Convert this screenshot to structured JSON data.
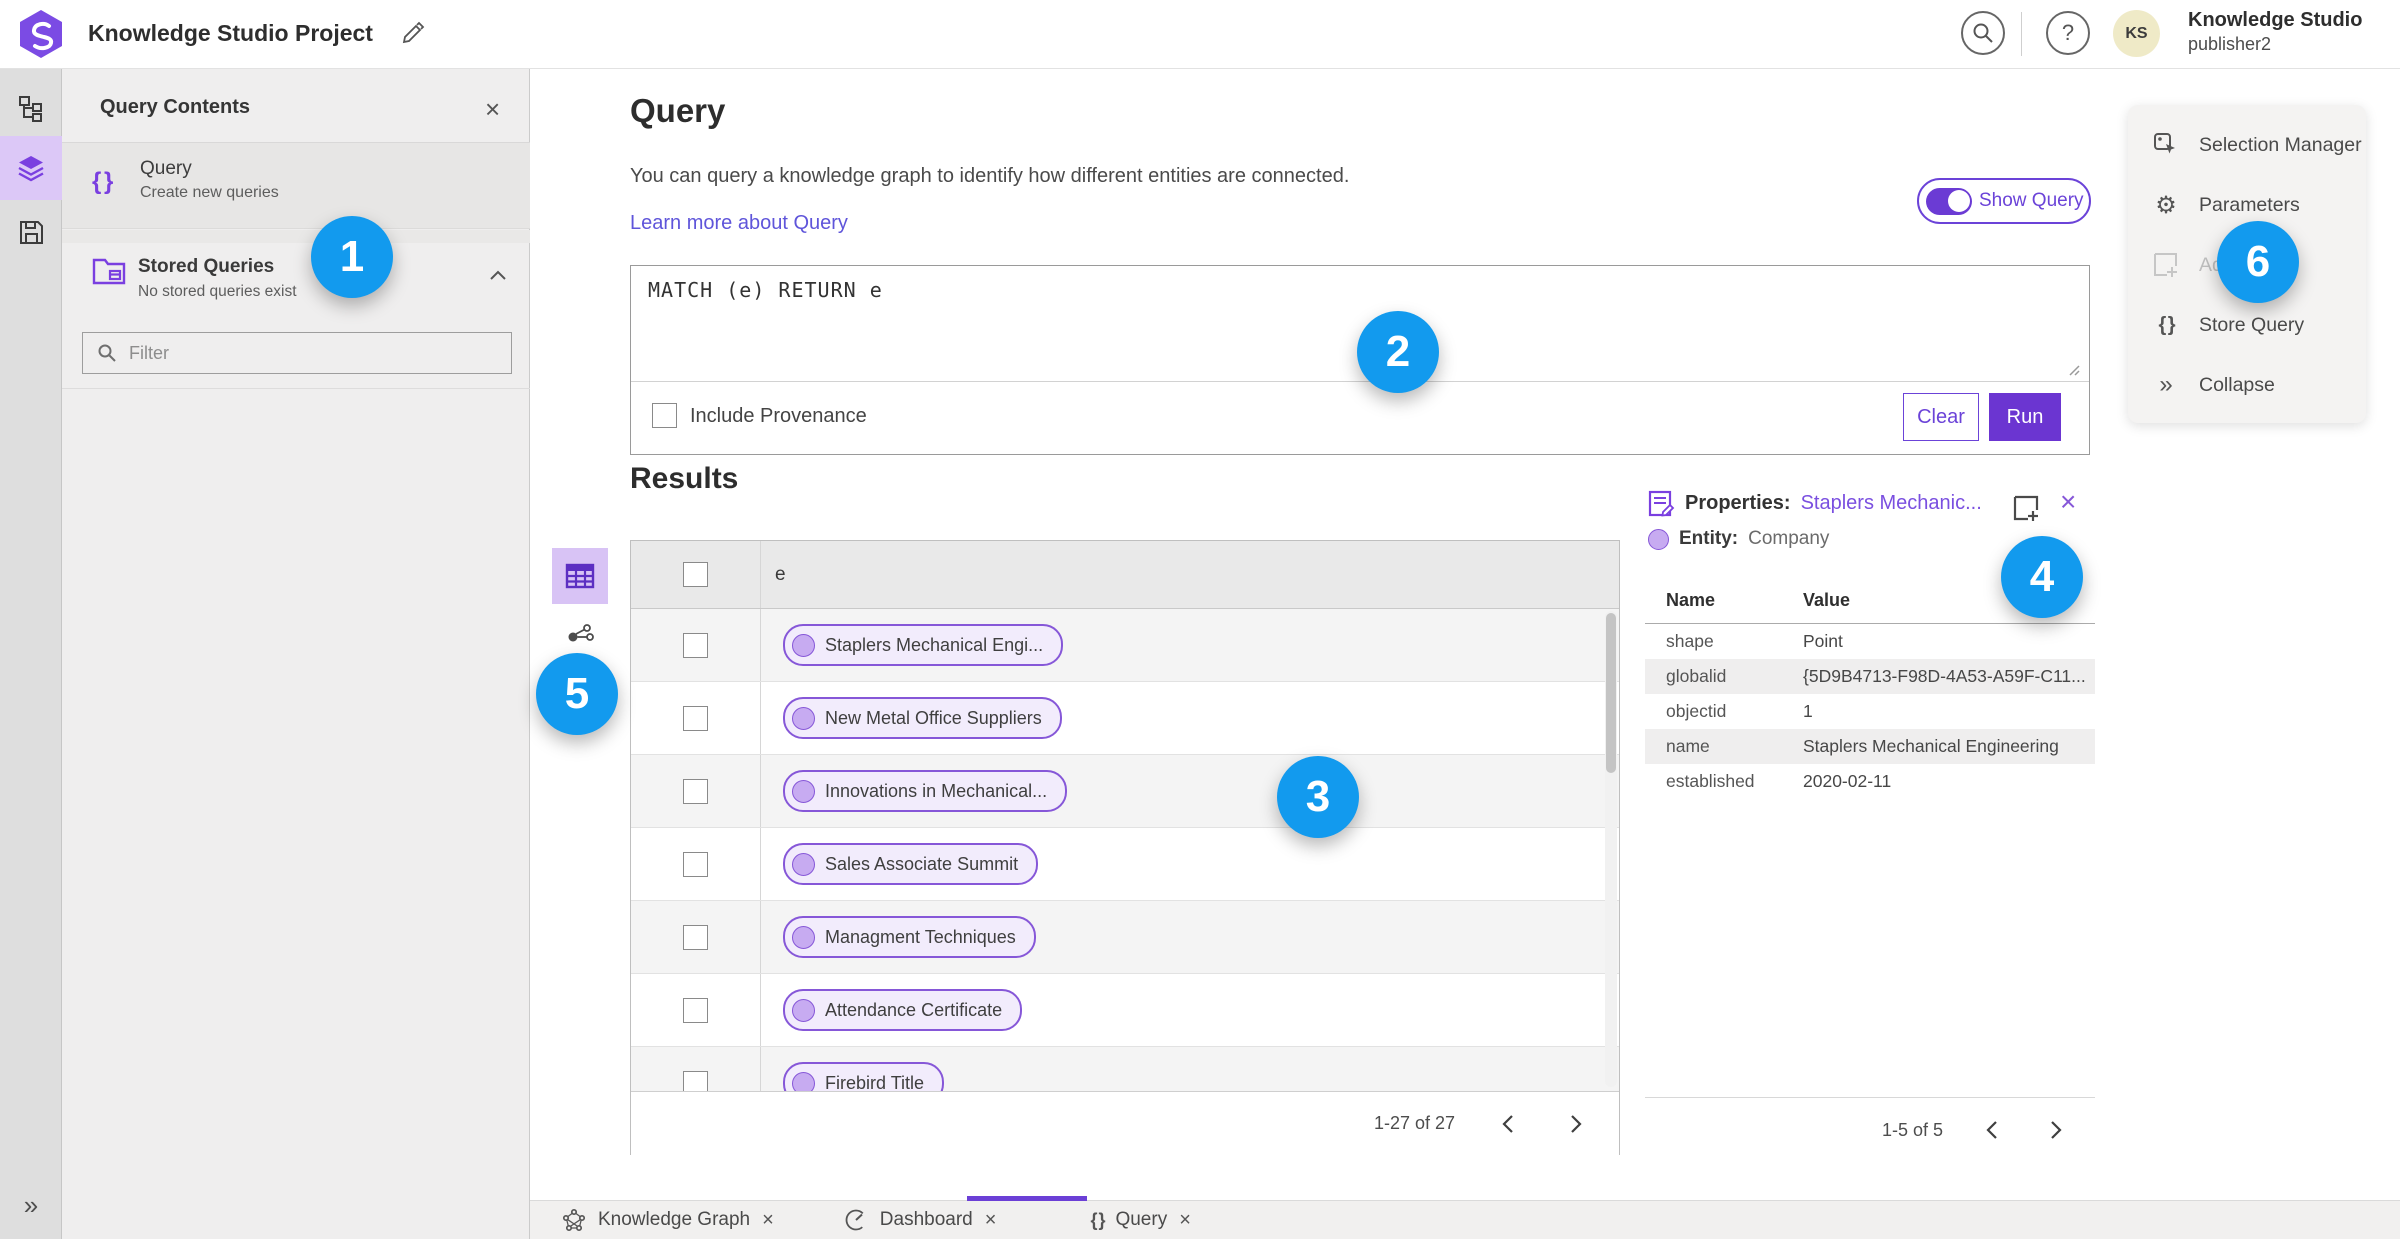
{
  "header": {
    "app_title": "Knowledge Studio Project",
    "user_name": "Knowledge Studio",
    "user_role": "publisher2",
    "avatar_initials": "KS",
    "help_glyph": "?"
  },
  "query_contents_panel": {
    "title": "Query Contents",
    "query_item": {
      "title": "Query",
      "subtitle": "Create new queries"
    },
    "stored_queries": {
      "title": "Stored Queries",
      "subtitle": "No stored queries exist"
    },
    "filter_placeholder": "Filter"
  },
  "query_section": {
    "title": "Query",
    "description": "You can query a knowledge graph to identify how different entities are connected.",
    "learn_more": "Learn more about Query",
    "show_query_label": "Show Query",
    "query_text": "MATCH (e) RETURN e",
    "include_provenance_label": "Include Provenance",
    "clear_label": "Clear",
    "run_label": "Run"
  },
  "results": {
    "title": "Results",
    "column_header": "e",
    "rows": [
      "Staplers Mechanical Engi...",
      "New Metal Office Suppliers",
      "Innovations in Mechanical...",
      "Sales Associate Summit",
      "Managment Techniques",
      "Attendance Certificate",
      "Firebird Title"
    ],
    "pagination": "1-27 of 27"
  },
  "properties_panel": {
    "title": "Properties:",
    "entity_link": "Staplers Mechanic...",
    "entity_label": "Entity:",
    "entity_type": "Company",
    "columns": {
      "name": "Name",
      "value": "Value"
    },
    "rows": [
      [
        "shape",
        "Point"
      ],
      [
        "globalid",
        "{5D9B4713-F98D-4A53-A59F-C11..."
      ],
      [
        "objectid",
        "1"
      ],
      [
        "name",
        "Staplers Mechanical Engineering"
      ],
      [
        "established",
        "2020-02-11"
      ]
    ],
    "pagination": "1-5 of 5"
  },
  "side_menu": {
    "items": [
      {
        "label": "Selection Manager"
      },
      {
        "label": "Parameters"
      },
      {
        "label": "Add",
        "disabled": true
      },
      {
        "label": "Store Query"
      },
      {
        "label": "Collapse"
      }
    ]
  },
  "bottom_tabs": {
    "tabs": [
      {
        "label": "Knowledge Graph"
      },
      {
        "label": "Dashboard"
      },
      {
        "label": "Query",
        "active": true
      }
    ]
  },
  "annotations": [
    "1",
    "2",
    "3",
    "4",
    "5",
    "6"
  ],
  "icons": {
    "close": "×",
    "braces": "{ }",
    "collapse_double_chevron": "»",
    "gear": "⚙",
    "chevron_up_caret": "",
    "help": "?"
  },
  "colors": {
    "accent_purple": "#6b3fd6",
    "light_purple": "#d8c3f5",
    "annotation_blue": "#129aee",
    "link_purple": "#5f55da",
    "avatar_yellow": "#efeac7"
  }
}
